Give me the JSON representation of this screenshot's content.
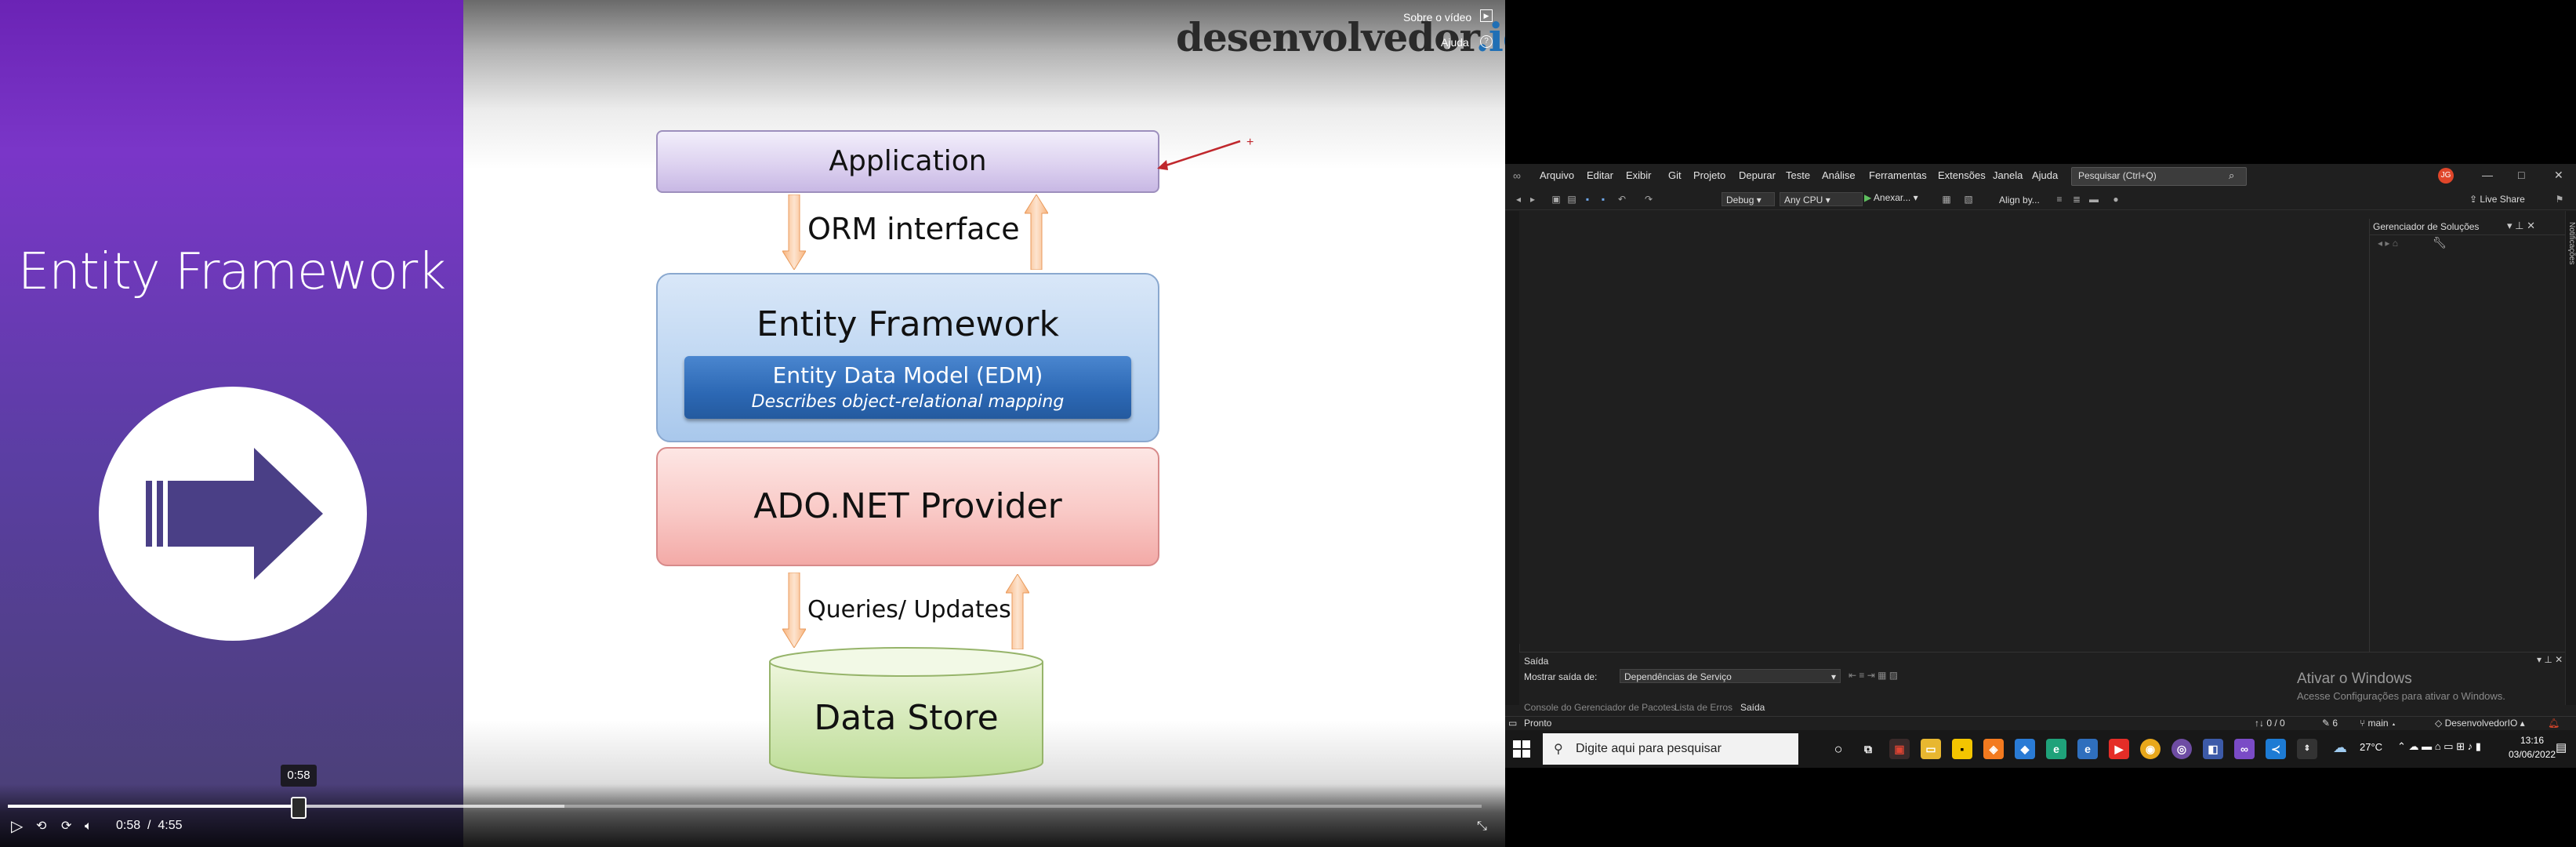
{
  "video": {
    "slide_title": "Entity Framework",
    "logo_main": "desenvolvedor",
    "logo_accent": ".io",
    "about_video": "Sobre o vídeo",
    "help": "Ajuda",
    "tooltip_time": "0:58",
    "current_time": "0:58",
    "separator": "/",
    "duration": "4:55",
    "progress_fraction": 0.197
  },
  "diagram": {
    "application": "Application",
    "orm_interface": "ORM interface",
    "entity_framework": "Entity Framework",
    "edm_title": "Entity Data Model (EDM)",
    "edm_subtitle": "Describes object-relational mapping",
    "ado_provider": "ADO.NET Provider",
    "queries_updates": "Queries/ Updates",
    "data_store": "Data Store"
  },
  "vs": {
    "menu": [
      "Arquivo",
      "Editar",
      "Exibir",
      "Git",
      "Projeto",
      "Depurar",
      "Teste",
      "Análise",
      "Ferramentas",
      "Extensões",
      "Janela",
      "Ajuda"
    ],
    "search_placeholder": "Pesquisar (Ctrl+Q)",
    "avatar_initials": "JG",
    "toolbar": {
      "config": "Debug",
      "platform": "Any CPU",
      "attach": "Anexar...",
      "align": "Align by...",
      "live_share": "Live Share"
    },
    "solution_explorer_title": "Gerenciador de Soluções",
    "notifications_label": "Notificações",
    "output": {
      "title": "Saída",
      "show_from_label": "Mostrar saída de:",
      "source": "Dependências de Serviço",
      "tabs": [
        "Console do Gerenciador de Pacotes",
        "Lista de Erros",
        "Saída"
      ]
    },
    "activate_windows": "Ativar o Windows",
    "activate_sub": "Acesse Configurações para ativar o Windows.",
    "status": {
      "ready": "Pronto",
      "lines": "↑↓ 0 / 0",
      "changes": "✎ 6",
      "branch": "main",
      "repo": "DesenvolvedorIO"
    }
  },
  "taskbar": {
    "search_placeholder": "Digite aqui para pesquisar",
    "temperature": "27°C",
    "time": "13:16",
    "date": "03/06/2022"
  },
  "colors": {
    "video_purple": "#6b23b5",
    "vs_background": "#1f1f1f",
    "accent_blue": "#1f6fb5"
  }
}
